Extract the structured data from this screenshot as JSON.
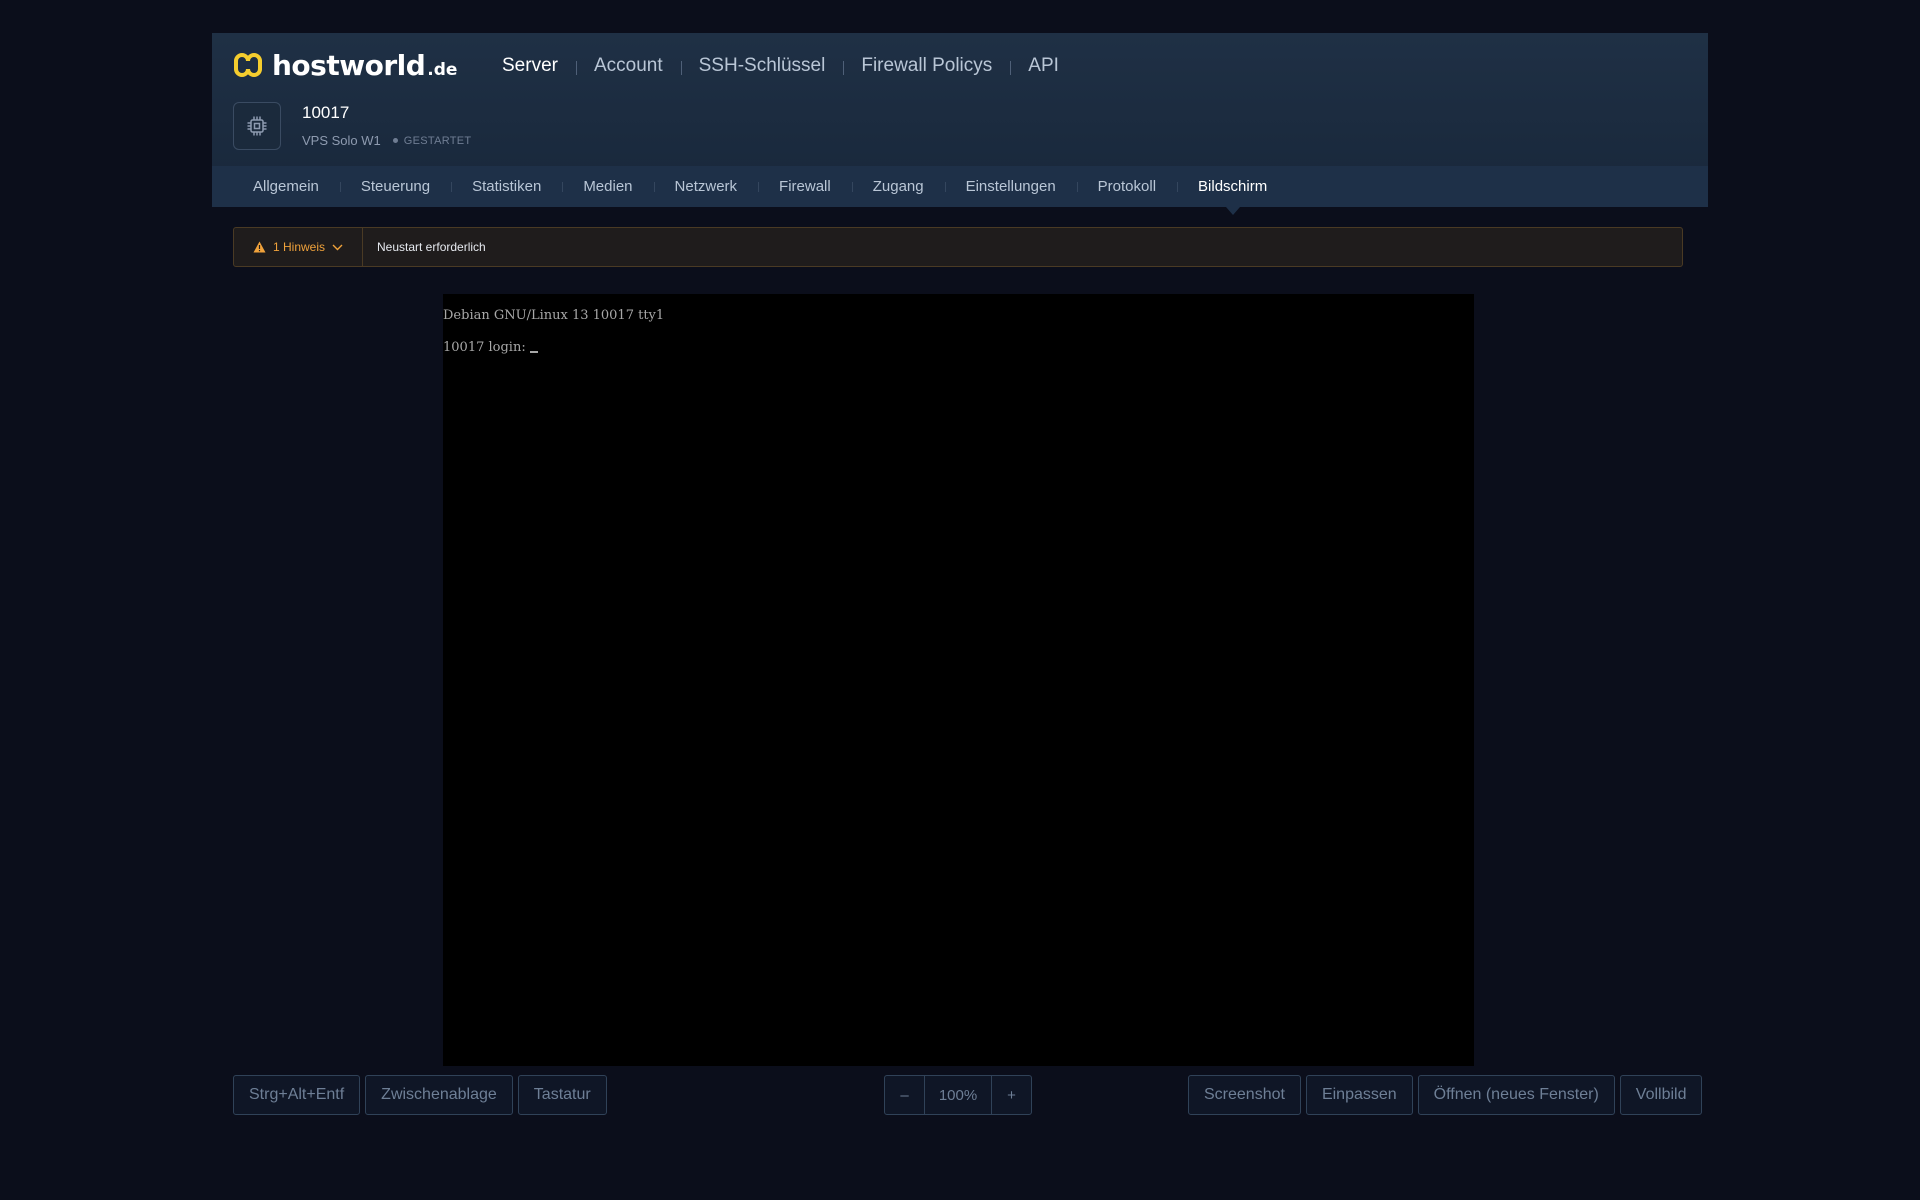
{
  "brand": {
    "name": "hostworld",
    "tld": ".de",
    "accent": "#f5cd2e"
  },
  "main_nav": [
    {
      "label": "Server",
      "active": true
    },
    {
      "label": "Account",
      "active": false
    },
    {
      "label": "SSH-Schlüssel",
      "active": false
    },
    {
      "label": "Firewall Policys",
      "active": false
    },
    {
      "label": "API",
      "active": false
    }
  ],
  "server": {
    "icon": "cpu-chip-icon",
    "name": "10017",
    "plan": "VPS Solo W1",
    "status": "GESTARTET"
  },
  "tabs": [
    {
      "label": "Allgemein"
    },
    {
      "label": "Steuerung"
    },
    {
      "label": "Statistiken"
    },
    {
      "label": "Medien"
    },
    {
      "label": "Netzwerk"
    },
    {
      "label": "Firewall"
    },
    {
      "label": "Zugang"
    },
    {
      "label": "Einstellungen"
    },
    {
      "label": "Protokoll"
    },
    {
      "label": "Bildschirm",
      "active": true
    }
  ],
  "alert": {
    "toggle_label": "1 Hinweis",
    "message": "Neustart erforderlich",
    "color": "#f0a23b"
  },
  "console": {
    "line1": "Debian GNU/Linux 13 10017 tty1",
    "line2": "10017 login:"
  },
  "toolbar": {
    "left": {
      "ctrl_alt_del": "Strg+Alt+Entf",
      "clipboard": "Zwischenablage",
      "keyboard": "Tastatur"
    },
    "zoom": {
      "minus": "–",
      "value": "100%",
      "plus": "+"
    },
    "right": {
      "screenshot": "Screenshot",
      "fit": "Einpassen",
      "open_new_window": "Öffnen (neues Fenster)",
      "fullscreen": "Vollbild"
    }
  }
}
